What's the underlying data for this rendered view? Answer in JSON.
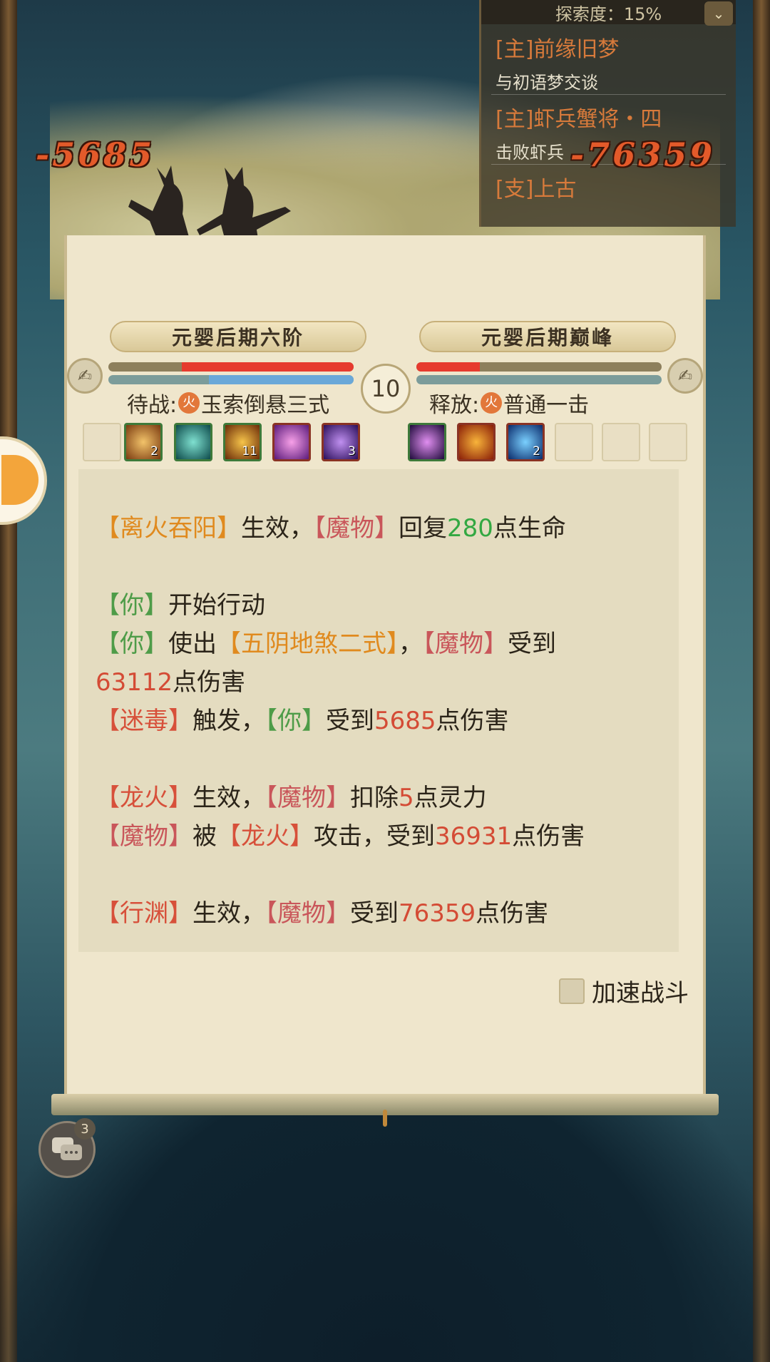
{
  "quest_tracker": {
    "explore_label": "探索度：15%",
    "quests": [
      {
        "title": "[主]前缘旧梦",
        "desc": "与初语梦交谈"
      },
      {
        "title": "[主]虾兵蟹将・四",
        "desc": "击败虾兵"
      },
      {
        "title": "[支]上古",
        "desc": ""
      }
    ]
  },
  "damage_popups": {
    "left": "-5685",
    "right": "-76359"
  },
  "battle": {
    "player_realm": "元婴后期六阶",
    "enemy_realm": "元婴后期巅峰",
    "round": "10",
    "player_hp_fraction": 0.7,
    "enemy_hp_fraction": 0.26,
    "player_mp_fraction": 0.59,
    "enemy_mp_fraction": 0.0,
    "player_skill_label": "待战:",
    "player_skill_name": "玉索倒悬三式",
    "enemy_skill_label": "释放:",
    "enemy_skill_name": "普通一击",
    "element_glyph": "火",
    "player_buffs": [
      {
        "icon": "golden-seal-icon",
        "count": "2"
      },
      {
        "icon": "jade-dragon-icon",
        "count": ""
      },
      {
        "icon": "fire-slash-icon",
        "count": "11"
      },
      {
        "icon": "purple-flame-icon",
        "count": ""
      },
      {
        "icon": "violet-vortex-icon",
        "count": "3"
      }
    ],
    "enemy_buffs": [
      {
        "icon": "shadow-flower-icon",
        "count": ""
      },
      {
        "icon": "fire-dragon-icon",
        "count": ""
      },
      {
        "icon": "blue-orb-icon",
        "count": "2"
      }
    ]
  },
  "log": {
    "l1": {
      "a": "【离火吞阳】",
      "b": "生效，",
      "c": "【魔物】",
      "d": "回复",
      "e": "280",
      "f": "点生命"
    },
    "l2": {
      "a": "【你】",
      "b": "开始行动"
    },
    "l3": {
      "a": "【你】",
      "b": "使出",
      "c": "【五阴地煞二式】",
      "d": "，",
      "e": "【魔物】",
      "f": "受到"
    },
    "l4": {
      "a": "63112",
      "b": "点伤害"
    },
    "l5": {
      "a": "【迷毒】",
      "b": "触发，",
      "c": "【你】",
      "d": "受到",
      "e": "5685",
      "f": "点伤害"
    },
    "l6": {
      "a": "【龙火】",
      "b": "生效，",
      "c": "【魔物】",
      "d": "扣除",
      "e": "5",
      "f": "点灵力"
    },
    "l7": {
      "a": "【魔物】",
      "b": "被",
      "c": "【龙火】",
      "d": "攻击，受到",
      "e": "36931",
      "f": "点伤害"
    },
    "l8": {
      "a": "【行渊】",
      "b": "生效，",
      "c": "【魔物】",
      "d": "受到",
      "e": "76359",
      "f": "点伤害"
    }
  },
  "speed_up_label": "加速战斗",
  "chat_badge": "3",
  "colors": {
    "hp": "#e63a2e",
    "mp": "#6aa8d8",
    "parchment": "#efe6cc"
  }
}
